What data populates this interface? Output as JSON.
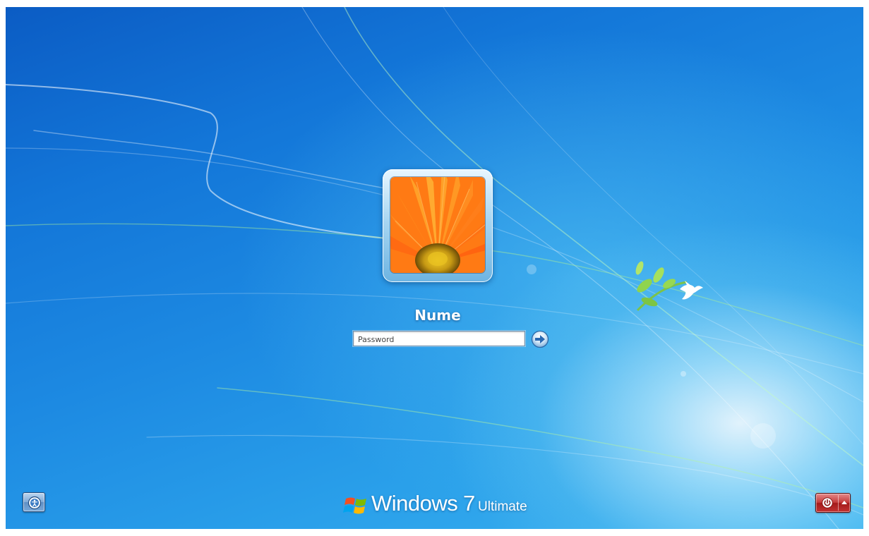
{
  "screen": {
    "name": "Windows 7 logon screen"
  },
  "user": {
    "display_name": "Nume",
    "avatar_icon": "orange-gerbera-flower-icon"
  },
  "login": {
    "password_placeholder": "Password",
    "password_value": "",
    "submit_icon": "arrow-right-icon"
  },
  "accessibility": {
    "icon": "ease-of-access-icon"
  },
  "branding": {
    "logo_icon": "windows-flag-icon",
    "product": "Windows",
    "version": "7",
    "edition": "Ultimate"
  },
  "power": {
    "shutdown_icon": "power-icon",
    "options_icon": "chevron-up-icon"
  },
  "colors": {
    "background_dark": "#0b5cc4",
    "background_light": "#3bb2f0",
    "power_red": "#c23232",
    "text_white": "#ffffff"
  }
}
